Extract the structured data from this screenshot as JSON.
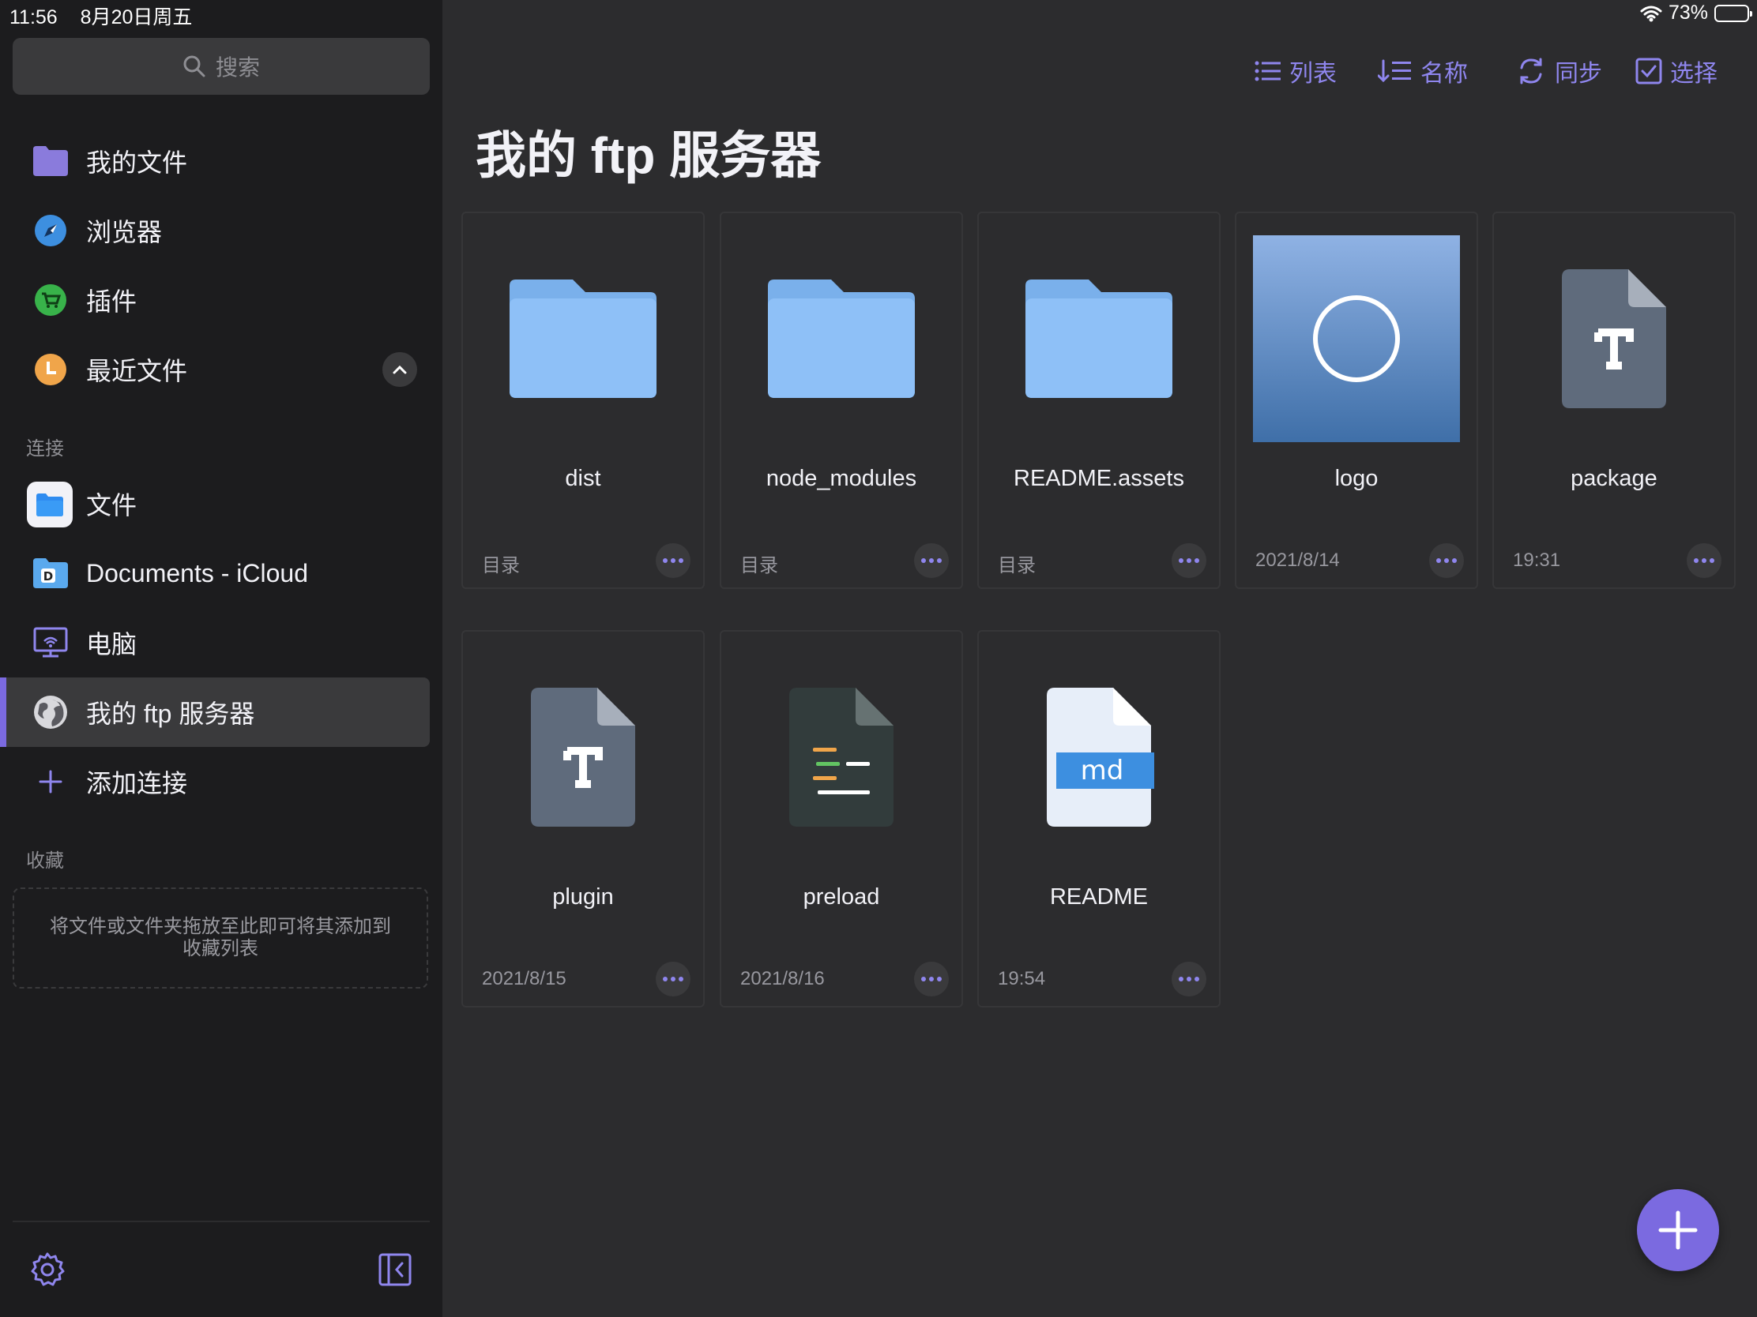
{
  "status": {
    "time": "11:56",
    "date": "8月20日周五",
    "battery": "73%",
    "battery_level": 0.73
  },
  "sidebar": {
    "search_placeholder": "搜索",
    "main_items": [
      {
        "label": "我的文件",
        "icon": "purple-folder-icon"
      },
      {
        "label": "浏览器",
        "icon": "compass-icon"
      },
      {
        "label": "插件",
        "icon": "cart-icon"
      },
      {
        "label": "最近文件",
        "icon": "clock-icon"
      }
    ],
    "connections_title": "连接",
    "connections": [
      {
        "label": "文件",
        "icon": "files-app-icon"
      },
      {
        "label": "Documents - iCloud",
        "icon": "documents-folder-icon"
      },
      {
        "label": "电脑",
        "icon": "computer-icon"
      },
      {
        "label": "我的 ftp 服务器",
        "icon": "globe-icon",
        "active": true
      },
      {
        "label": "添加连接",
        "icon": "plus-icon"
      }
    ],
    "favorites_title": "收藏",
    "favorites_hint": "将文件或文件夹拖放至此即可将其添加到收藏列表"
  },
  "toolbar": {
    "list": "列表",
    "sort": "名称",
    "sync": "同步",
    "select": "选择"
  },
  "page_title": "我的 ftp 服务器",
  "files": [
    {
      "name": "dist",
      "meta": "目录",
      "type": "folder"
    },
    {
      "name": "node_modules",
      "meta": "目录",
      "type": "folder"
    },
    {
      "name": "README.assets",
      "meta": "目录",
      "type": "folder"
    },
    {
      "name": "logo",
      "meta": "2021/8/14",
      "type": "image"
    },
    {
      "name": "package",
      "meta": "19:31",
      "type": "text"
    },
    {
      "name": "plugin",
      "meta": "2021/8/15",
      "type": "text"
    },
    {
      "name": "preload",
      "meta": "2021/8/16",
      "type": "code"
    },
    {
      "name": "README",
      "meta": "19:54",
      "type": "markdown",
      "badge": "md"
    }
  ],
  "colors": {
    "accent": "#8f86ee",
    "fab": "#7b6ae0",
    "folder": "#8ec0f7",
    "sidebar_bg": "#1c1c1e",
    "main_bg": "#2c2c2e"
  }
}
